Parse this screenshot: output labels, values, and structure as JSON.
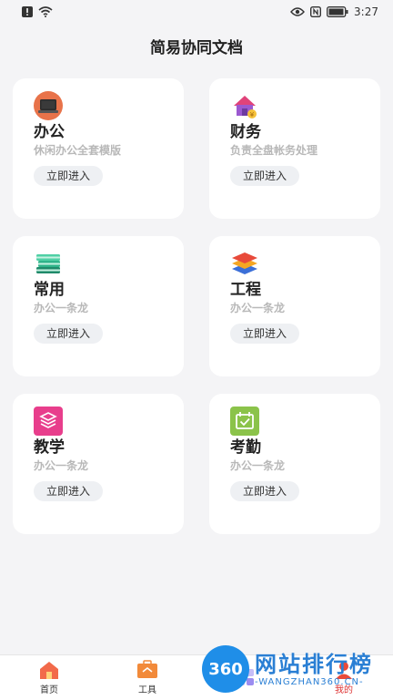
{
  "status_bar": {
    "time": "3:27"
  },
  "header": {
    "title": "简易协同文档"
  },
  "cards": [
    {
      "title": "办公",
      "subtitle": "休闲办公全套模版",
      "button": "立即进入",
      "icon": "monitor-icon"
    },
    {
      "title": "财务",
      "subtitle": "负责全盘帐务处理",
      "button": "立即进入",
      "icon": "house-coin-icon"
    },
    {
      "title": "常用",
      "subtitle": "办公一条龙",
      "button": "立即进入",
      "icon": "books-icon"
    },
    {
      "title": "工程",
      "subtitle": "办公一条龙",
      "button": "立即进入",
      "icon": "layers-icon"
    },
    {
      "title": "教学",
      "subtitle": "办公一条龙",
      "button": "立即进入",
      "icon": "stack-icon"
    },
    {
      "title": "考勤",
      "subtitle": "办公一条龙",
      "button": "立即进入",
      "icon": "calendar-check-icon"
    }
  ],
  "tab_bar": {
    "items": [
      {
        "label": "首页"
      },
      {
        "label": "工具"
      },
      {
        "label": ""
      },
      {
        "label": "我的"
      }
    ]
  },
  "watermark": {
    "logo": "360",
    "text": "网站排行榜",
    "url": "-WANGZHAN360.CN-"
  },
  "colors": {
    "background": "#f4f4f6",
    "card": "#ffffff",
    "button_bg": "#eef0f3",
    "subtitle": "#b8b8b8"
  }
}
